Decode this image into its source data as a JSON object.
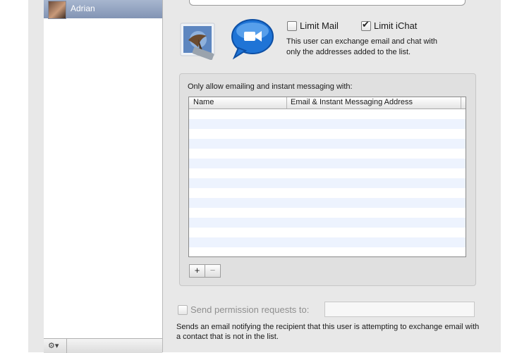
{
  "sidebar": {
    "users": [
      {
        "name": "Adrian",
        "selected": true
      }
    ],
    "gear_label": "⚙▾"
  },
  "parental": {
    "limit_mail": {
      "label": "Limit Mail",
      "checked": false
    },
    "limit_ichat": {
      "label": "Limit iChat",
      "checked": true
    },
    "description": "This user can exchange email and chat with only the addresses added to the list.",
    "list_title": "Only allow emailing and instant messaging with:",
    "columns": [
      "Name",
      "Email & Instant Messaging Address"
    ],
    "rows": [],
    "add_label": "+",
    "remove_label": "−",
    "permission": {
      "label": "Send permission requests to:",
      "checked": false,
      "value": "",
      "description": "Sends an email notifying the recipient that this user is attempting to exchange email with a contact that is not in the list."
    }
  },
  "colors": {
    "selection": "#8a9bba",
    "row_alt": "#edf3fe",
    "window": "#e8e8e8"
  },
  "icons": [
    "mail-stamp-icon",
    "ichat-icon",
    "gear-icon"
  ]
}
